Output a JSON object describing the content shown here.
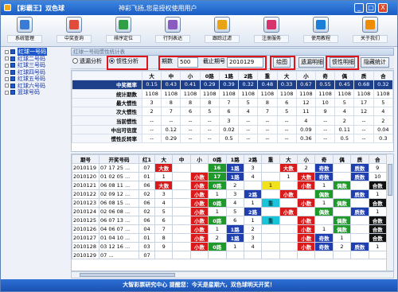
{
  "window": {
    "title": "【彩霸王】双色球",
    "subtitle": "神彩飞扬,您是授权使用用户",
    "controls": [
      "_",
      "□",
      "X"
    ]
  },
  "toolbar": [
    {
      "label": "系统管理",
      "icon": "system-icon",
      "color": "#3a7bd5"
    },
    {
      "label": "中奖查询",
      "icon": "query-icon",
      "color": "#e04b3a"
    },
    {
      "label": "排序定位",
      "icon": "sort-icon",
      "color": "#2f9e44"
    },
    {
      "label": "行列表达",
      "icon": "table-icon",
      "color": "#8a5cc2"
    },
    {
      "label": "跟踪过滤",
      "icon": "filter-icon",
      "color": "#e8a317"
    },
    {
      "label": "注册服务",
      "icon": "register-icon",
      "color": "#d6336c"
    },
    {
      "label": "使用教程",
      "icon": "tutorial-icon",
      "color": "#1c7ed6"
    },
    {
      "label": "关于我们",
      "icon": "about-icon",
      "color": "#f08c00"
    }
  ],
  "tree": [
    "红球一号码",
    "红球二号码",
    "红球三号码",
    "红球四号码",
    "红球五号码",
    "红球六号码",
    "篮球号码"
  ],
  "tab_title": "红球一号码惯性统计表",
  "options": {
    "radio1": "遗漏分析",
    "radio2": "惯性分析",
    "period_label": "期数",
    "period_value": "500",
    "end_label": "截止期号",
    "end_value": "2010129",
    "plot": "绘图",
    "detail1": "遗漏明细",
    "detail2": "惯性明细",
    "hide": "隐藏统计"
  },
  "stats": {
    "headers": [
      "大",
      "中",
      "小",
      "0路",
      "1路",
      "2路",
      "重",
      "大",
      "小",
      "奇",
      "偶",
      "质",
      "合"
    ],
    "rows": [
      {
        "label": "中奖概率",
        "values": [
          "0.15",
          "0.43",
          "0.41",
          "0.29",
          "0.39",
          "0.32",
          "0.48",
          "0.33",
          "0.67",
          "0.55",
          "0.45",
          "0.68",
          "0.32"
        ]
      },
      {
        "label": "统计期数",
        "values": [
          "1108",
          "1108",
          "1108",
          "1108",
          "1108",
          "1108",
          "1108",
          "1108",
          "1108",
          "1108",
          "1108",
          "1108",
          "1108"
        ]
      },
      {
        "label": "最大惯性",
        "values": [
          "3",
          "8",
          "8",
          "8",
          "7",
          "5",
          "8",
          "6",
          "12",
          "10",
          "5",
          "17",
          "5"
        ]
      },
      {
        "label": "次大惯性",
        "values": [
          "2",
          "7",
          "6",
          "5",
          "6",
          "4",
          "7",
          "5",
          "11",
          "9",
          "4",
          "12",
          "4"
        ]
      },
      {
        "label": "当前惯性",
        "values": [
          "--",
          "--",
          "--",
          "--",
          "3",
          "--",
          "--",
          "--",
          "4",
          "--",
          "2",
          "--",
          "2"
        ]
      },
      {
        "label": "中出可信度",
        "values": [
          "--",
          "0.12",
          "--",
          "--",
          "0.02",
          "--",
          "--",
          "--",
          "0.09",
          "--",
          "0.11",
          "--",
          "0.04"
        ]
      },
      {
        "label": "惯性反转率",
        "values": [
          "--",
          "0.29",
          "--",
          "--",
          "0.5",
          "--",
          "--",
          "--",
          "0.36",
          "--",
          "0.5",
          "--",
          "0.3"
        ]
      }
    ]
  },
  "grid": {
    "headers": [
      "期号",
      "开奖号码",
      "红1",
      "大",
      "中",
      "小",
      "0路",
      "1路",
      "2路",
      "重",
      "大",
      "小",
      "奇",
      "偶",
      "质",
      "合"
    ],
    "rows": [
      {
        "issue": "2010119",
        "nums": "07 17 25 ...",
        "r1": "07",
        "cells": [
          "大数",
          "",
          "",
          "16",
          "1路",
          "3",
          "",
          "大数",
          "2",
          "奇数",
          "",
          "质数",
          "9"
        ],
        "cls": [
          "c-r",
          "",
          "",
          "c-g",
          "c-b",
          "",
          "",
          "c-r",
          "",
          "c-b",
          "",
          "c-b",
          ""
        ]
      },
      {
        "issue": "2010120",
        "nums": "01 02 05 ...",
        "r1": "01",
        "cells": [
          "1",
          "",
          "小数",
          "17",
          "1路",
          "4",
          "",
          "1",
          "大数",
          "奇数",
          "",
          "质数",
          "10"
        ],
        "cls": [
          "",
          "",
          "c-r",
          "c-g",
          "c-b",
          "",
          "",
          "",
          "c-r",
          "c-b",
          "",
          "c-b",
          ""
        ]
      },
      {
        "issue": "2010121",
        "nums": "06 08 11 ...",
        "r1": "06",
        "cells": [
          "大数",
          "",
          "小数",
          "0路",
          "2",
          "",
          "1",
          "",
          "小数",
          "1",
          "偶数",
          "",
          "合数"
        ],
        "cls": [
          "c-r",
          "",
          "c-r",
          "c-g",
          "",
          "",
          "c-y",
          "",
          "c-r",
          "",
          "c-g",
          "",
          "c-k"
        ]
      },
      {
        "issue": "2010122",
        "nums": "02 09 12 ...",
        "r1": "02",
        "cells": [
          "3",
          "",
          "小数",
          "1",
          "3",
          "2路",
          "",
          "小数",
          "",
          "偶数",
          "",
          "质数",
          "1"
        ],
        "cls": [
          "",
          "",
          "c-r",
          "",
          "",
          "c-b",
          "",
          "c-r",
          "",
          "c-g",
          "",
          "c-b",
          ""
        ]
      },
      {
        "issue": "2010123",
        "nums": "06 08 15 ...",
        "r1": "06",
        "cells": [
          "4",
          "",
          "小数",
          "0路",
          "4",
          "1",
          "重",
          "",
          "小数",
          "1",
          "偶数",
          "",
          "合数"
        ],
        "cls": [
          "",
          "",
          "c-r",
          "c-g",
          "",
          "",
          "c-c",
          "",
          "c-r",
          "",
          "c-g",
          "",
          "c-k"
        ]
      },
      {
        "issue": "2010124",
        "nums": "02 06 08 ...",
        "r1": "02",
        "cells": [
          "5",
          "",
          "小数",
          "1",
          "5",
          "2路",
          "",
          "小数",
          "",
          "偶数",
          "",
          "质数",
          "1"
        ],
        "cls": [
          "",
          "",
          "c-r",
          "",
          "",
          "c-b",
          "",
          "c-r",
          "",
          "c-g",
          "",
          "c-b",
          ""
        ]
      },
      {
        "issue": "2010125",
        "nums": "06 07 13 ...",
        "r1": "06",
        "cells": [
          "6",
          "",
          "小数",
          "0路",
          "6",
          "1",
          "重",
          "",
          "小数",
          "",
          "偶数",
          "",
          "合数"
        ],
        "cls": [
          "",
          "",
          "c-r",
          "c-g",
          "",
          "",
          "c-c",
          "",
          "c-r",
          "",
          "c-g",
          "",
          "c-k"
        ]
      },
      {
        "issue": "2010126",
        "nums": "04 06 07 ...",
        "r1": "04",
        "cells": [
          "7",
          "",
          "小数",
          "1",
          "1路",
          "2",
          "",
          "",
          "小数",
          "1",
          "偶数",
          "",
          "合数"
        ],
        "cls": [
          "",
          "",
          "c-r",
          "",
          "c-b",
          "",
          "",
          "",
          "c-r",
          "",
          "c-g",
          "",
          "c-k"
        ]
      },
      {
        "issue": "2010127",
        "nums": "01 04 10 ...",
        "r1": "01",
        "cells": [
          "8",
          "",
          "小数",
          "2",
          "1路",
          "3",
          "",
          "",
          "小数",
          "奇数",
          "1",
          "",
          "合数"
        ],
        "cls": [
          "",
          "",
          "c-r",
          "",
          "c-b",
          "",
          "",
          "",
          "c-r",
          "c-b",
          "",
          "",
          "c-k"
        ]
      },
      {
        "issue": "2010128",
        "nums": "03 12 16 ...",
        "r1": "03",
        "cells": [
          "9",
          "",
          "小数",
          "0路",
          "1",
          "4",
          "",
          "",
          "小数",
          "奇数",
          "2",
          "质数",
          "1"
        ],
        "cls": [
          "",
          "",
          "c-r",
          "c-g",
          "",
          "",
          "",
          "",
          "c-r",
          "c-b",
          "",
          "c-b",
          ""
        ]
      },
      {
        "issue": "2010129",
        "nums": "07 ...",
        "r1": "07",
        "cells": [
          "",
          "",
          "",
          "",
          "",
          "",
          "",
          "",
          "",
          "",
          "",
          "",
          ""
        ],
        "cls": [
          "",
          "",
          "",
          "",
          "",
          "",
          "",
          "",
          "",
          "",
          "",
          "",
          ""
        ]
      }
    ]
  },
  "status": "大智彩票研究中心 提醒您：今天是星期六，双色球明天开奖！"
}
